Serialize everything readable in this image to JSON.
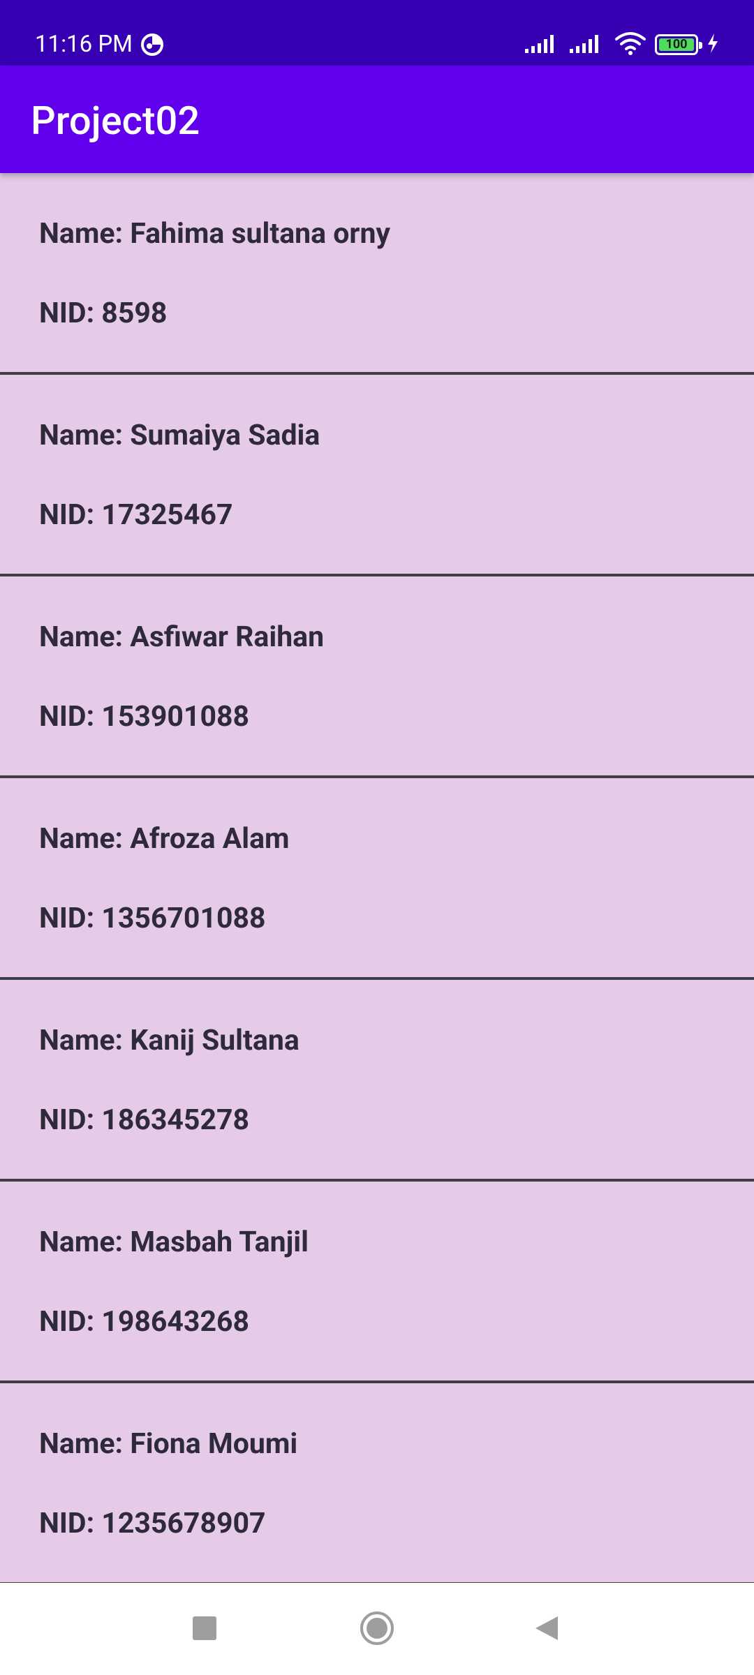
{
  "status_bar": {
    "time": "11:16 PM",
    "battery_level": "100",
    "icons": [
      "data-saver-icon",
      "signal-icon",
      "signal-icon",
      "wifi-icon",
      "battery-icon",
      "charging-icon"
    ]
  },
  "app_bar": {
    "title": "Project02"
  },
  "items": [
    {
      "name": "Name: Fahima sultana orny",
      "nid": "NID: 8598"
    },
    {
      "name": "Name: Sumaiya Sadia",
      "nid": "NID: 17325467"
    },
    {
      "name": "Name: Asfiwar Raihan",
      "nid": "NID: 153901088"
    },
    {
      "name": "Name: Afroza Alam",
      "nid": "NID: 1356701088"
    },
    {
      "name": "Name: Kanij Sultana",
      "nid": "NID: 186345278"
    },
    {
      "name": "Name: Masbah Tanjil",
      "nid": "NID: 198643268"
    },
    {
      "name": "Name: Fiona Moumi",
      "nid": "NID: 1235678907"
    }
  ],
  "nav_bar": {
    "buttons": [
      "recents-icon",
      "home-icon",
      "back-icon"
    ]
  },
  "colors": {
    "status_bar": "#3700b3",
    "app_bar": "#6200ee",
    "list_background": "#e6cbe9",
    "divider": "#3d3d45",
    "text": "#2e2a3a"
  }
}
